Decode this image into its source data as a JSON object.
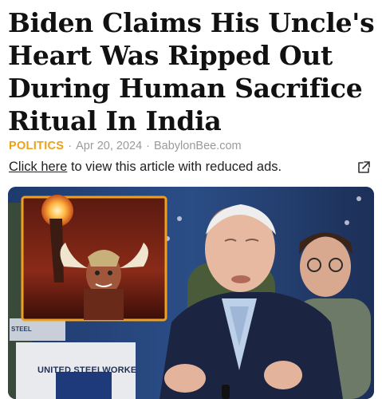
{
  "article": {
    "headline": "Biden Claims His Uncle's Heart Was Ripped Out During Human Sacrifice Ritual In India",
    "category": "POLITICS",
    "date": "Apr 20, 2024",
    "source": "BabylonBee.com",
    "separator": "·"
  },
  "reduced_ads": {
    "link_label": "Click here",
    "text": "to view this article with reduced ads.",
    "icon": "external-link-icon"
  },
  "photo": {
    "banner_text": "UNITED STEELWORKE",
    "steel_text": "STEEL",
    "inset_icon": "temple-ritual-image",
    "accent_color": "#e8a317",
    "inset_border_color": "#f0a020"
  }
}
